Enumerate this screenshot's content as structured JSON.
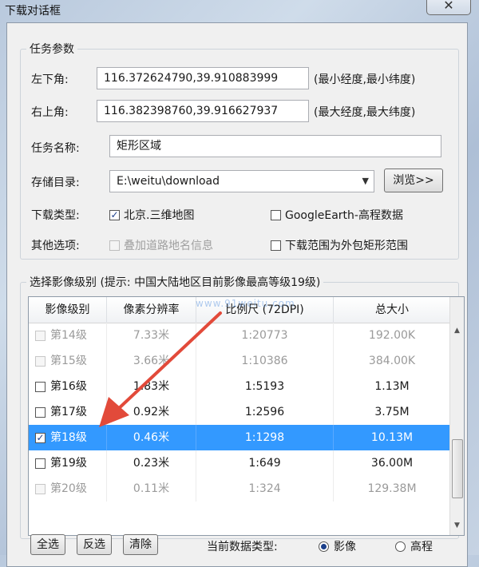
{
  "window": {
    "title": "下载对话框",
    "close_glyph": "✕"
  },
  "task_params": {
    "legend": "任务参数",
    "bottom_left_label": "左下角:",
    "bottom_left_value": "116.372624790,39.910883999",
    "bottom_left_hint": "(最小经度,最小纬度)",
    "top_right_label": "右上角:",
    "top_right_value": "116.382398760,39.916627937",
    "top_right_hint": "(最大经度,最大纬度)",
    "task_name_label": "任务名称:",
    "task_name_value": "矩形区域",
    "save_dir_label": "存储目录:",
    "save_dir_value": "E:\\weitu\\download",
    "browse_label": "浏览>>",
    "download_type_label": "下载类型:",
    "type_beijing_label": "北京.三维地图",
    "type_beijing_checked": "✓",
    "type_elevation_label": "GoogleEarth-高程数据",
    "other_options_label": "其他选项:",
    "opt_overlay_label": "叠加道路地名信息",
    "opt_outer_rect_label": "下载范围为外包矩形范围"
  },
  "levels": {
    "legend": "选择影像级别 (提示: 中国大陆地区目前影像最高等级19级)",
    "watermark": "www.91weitu.com",
    "columns": [
      "影像级别",
      "像素分辨率",
      "比例尺 (72DPI)",
      "总大小"
    ],
    "rows": [
      {
        "level": "第14级",
        "res": "7.33米",
        "scale": "1:20773",
        "size": "192.00K",
        "checked": ""
      },
      {
        "level": "第15级",
        "res": "3.66米",
        "scale": "1:10386",
        "size": "384.00K",
        "checked": ""
      },
      {
        "level": "第16级",
        "res": "1.83米",
        "scale": "1:5193",
        "size": "1.13M",
        "checked": ""
      },
      {
        "level": "第17级",
        "res": "0.92米",
        "scale": "1:2596",
        "size": "3.75M",
        "checked": ""
      },
      {
        "level": "第18级",
        "res": "0.46米",
        "scale": "1:1298",
        "size": "10.13M",
        "checked": "✓"
      },
      {
        "level": "第19级",
        "res": "0.23米",
        "scale": "1:649",
        "size": "36.00M",
        "checked": ""
      },
      {
        "level": "第20级",
        "res": "0.11米",
        "scale": "1:324",
        "size": "129.38M",
        "checked": ""
      }
    ],
    "scroll_up": "▲",
    "scroll_down": "▼"
  },
  "footer": {
    "select_all": "全选",
    "invert": "反选",
    "clear": "清除",
    "data_type_label": "当前数据类型:",
    "radio_imagery": "影像",
    "radio_elevation": "高程"
  },
  "colors": {
    "selection": "#3399ff",
    "annotation_arrow": "#e24a3a"
  }
}
